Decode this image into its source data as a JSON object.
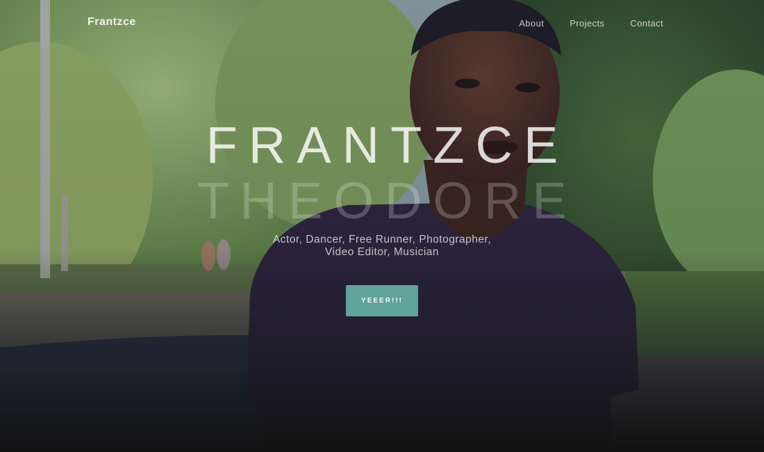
{
  "navbar": {
    "brand": "Frantzce",
    "links": [
      {
        "label": "About"
      },
      {
        "label": "Projects"
      },
      {
        "label": "Contact"
      }
    ]
  },
  "hero": {
    "first_name": "FRANTZCE",
    "last_name": "THEODORE",
    "tagline": "Actor, Dancer, Free Runner, Photographer, Video Editor, Musician",
    "cta_label": "YEEER!!!"
  },
  "colors": {
    "accent": "#5fa39a",
    "shirt": "#2e2440",
    "foliage": "#6f9a4c",
    "overlay": "#1e1e2d"
  }
}
